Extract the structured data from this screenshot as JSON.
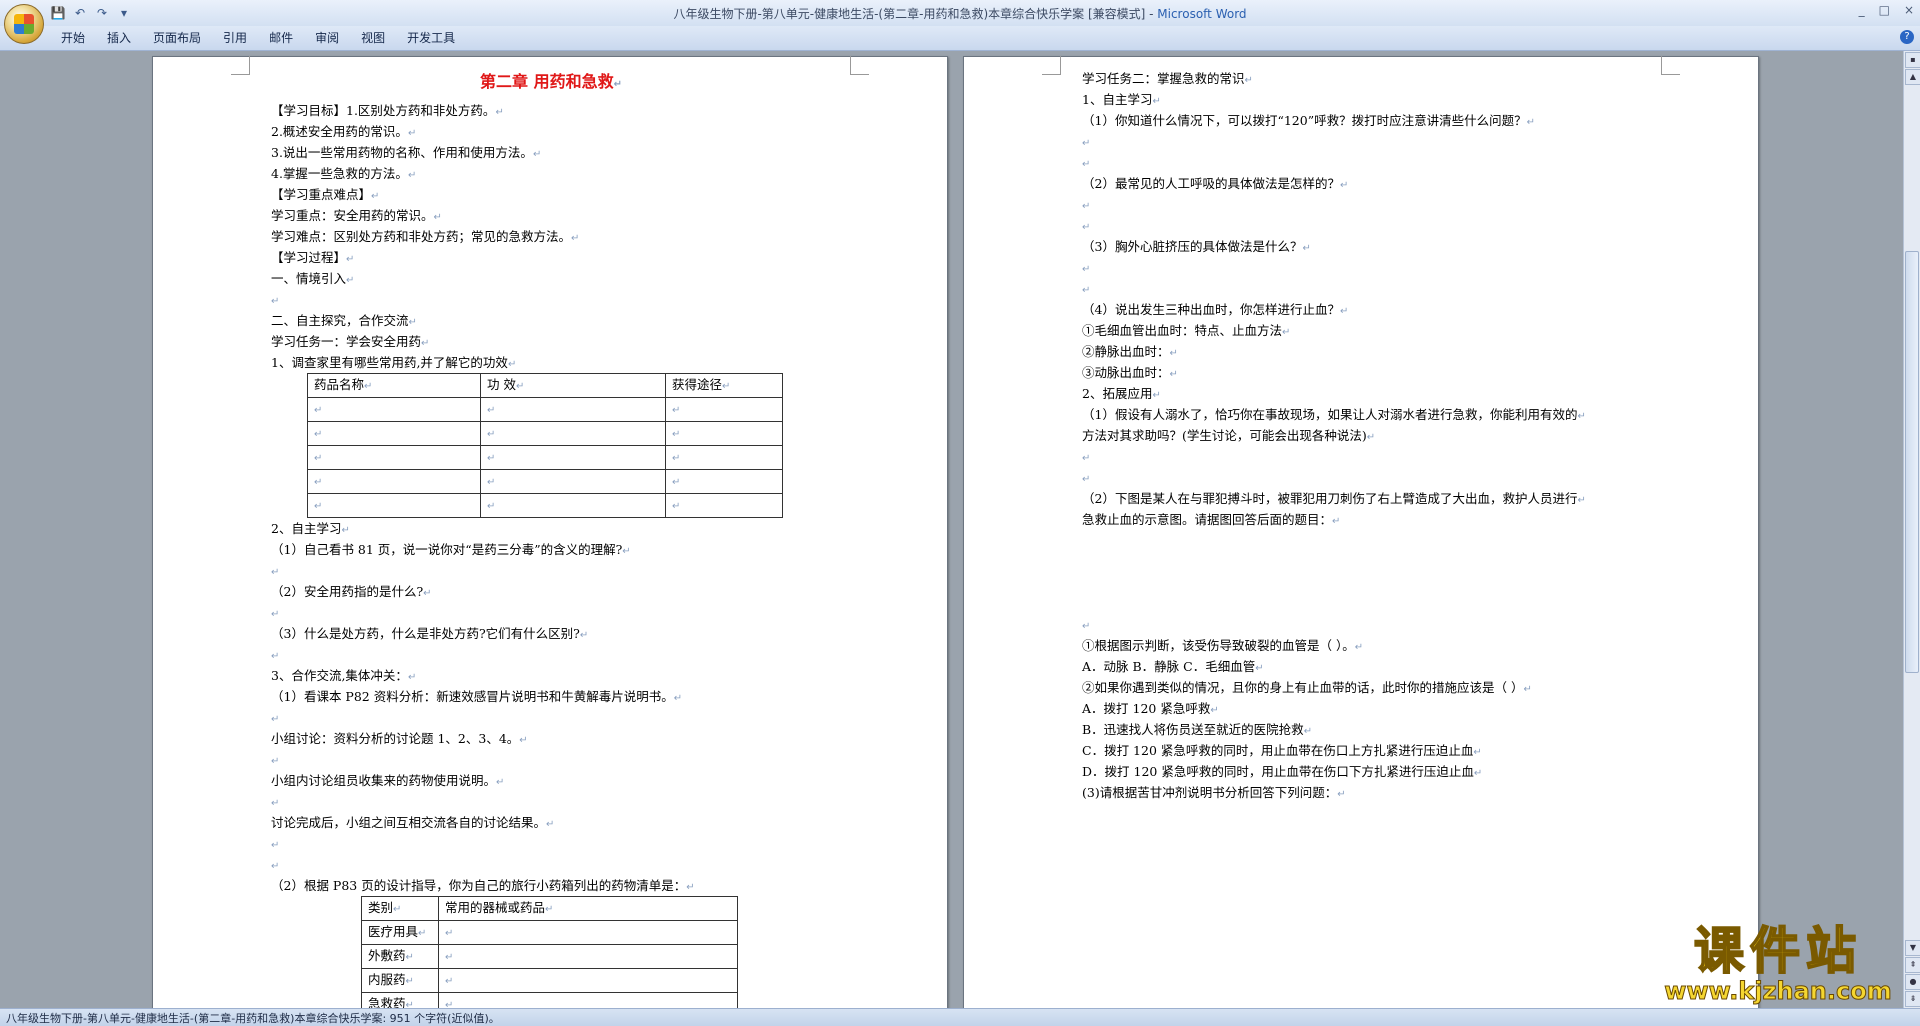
{
  "window": {
    "title": "八年级生物下册-第八单元-健康地生活-(第二章-用药和急救)本章综合快乐学案 [兼容模式] - ",
    "app": "Microsoft Word",
    "controls": [
      "_",
      "□",
      "×"
    ]
  },
  "quick_access": {
    "save": "💾",
    "undo": "↶",
    "redo": "↷",
    "customize": "▾"
  },
  "ribbon_tabs": [
    "开始",
    "插入",
    "页面布局",
    "引用",
    "邮件",
    "审阅",
    "视图",
    "开发工具"
  ],
  "page1": {
    "title": "第二章  用药和急救",
    "lines_a": [
      "【学习目标】1.区别处方药和非处方药。",
      "2.概述安全用药的常识。",
      "3.说出一些常用药物的名称、作用和使用方法。",
      "4.掌握一些急救的方法。",
      "【学习重点难点】",
      "学习重点：安全用药的常识。",
      "学习难点：区别处方药和非处方药；常见的急救方法。",
      "【学习过程】",
      "一、情境引入",
      "",
      "二、自主探究，合作交流",
      "学习任务一：学会安全用药",
      "1、调查家里有哪些常用药,并了解它的功效"
    ],
    "table1": {
      "headers": [
        "药品名称",
        "功        效",
        "获得途径"
      ],
      "empty_rows": 5
    },
    "lines_b": [
      "2、自主学习",
      "（1）自己看书 81 页，说一说你对“是药三分毒”的含义的理解?",
      "",
      "（2）安全用药指的是什么?",
      "",
      "（3）什么是处方药，什么是非处方药?它们有什么区别?",
      "",
      "3、合作交流,集体冲关：",
      "（1）看课本 P82 资料分析：新速效感冒片说明书和牛黄解毒片说明书。",
      "",
      "小组讨论：资料分析的讨论题 1、2、3、4。",
      "",
      "小组内讨论组员收集来的药物使用说明。",
      "",
      "讨论完成后，小组之间互相交流各自的讨论结果。",
      "",
      "",
      "（2）根据 P83 页的设计指导，你为自己的旅行小药箱列出的药物清单是："
    ],
    "table2": {
      "headers": [
        "类别",
        "常用的器械或药品"
      ],
      "rows": [
        "医疗用具",
        "外敷药",
        "内服药",
        "急救药"
      ]
    }
  },
  "page2": {
    "lines": [
      "学习任务二：掌握急救的常识",
      "1、自主学习",
      "（1）你知道什么情况下，可以拨打“120”呼救？拨打时应注意讲清些什么问题？",
      "",
      "",
      "（2）最常见的人工呼吸的具体做法是怎样的？",
      "",
      "",
      "（3）胸外心脏挤压的具体做法是什么？",
      "",
      "",
      "（4）说出发生三种出血时，你怎样进行止血？",
      "①毛细血管出血时：特点、止血方法",
      "②静脉出血时：",
      "③动脉出血时：",
      "2、拓展应用",
      "（1）假设有人溺水了，恰巧你在事故现场，如果让人对溺水者进行急救，你能利用有效的",
      "方法对其求助吗？(学生讨论，可能会出现各种说法)",
      "",
      "",
      "（2）下图是某人在与罪犯搏斗时，被罪犯用刀刺伤了右上臂造成了大出血，救护人员进行",
      "急救止血的示意图。请据图回答后面的题目："
    ],
    "lines_c": [
      "",
      "①根据图示判断，该受伤导致破裂的血管是（         ）。",
      "A．动脉            B．静脉            C．毛细血管",
      "②如果你遇到类似的情况，且你的身上有止血带的话，此时你的措施应该是（         ）",
      "A．拨打 120 紧急呼救",
      "B．迅速找人将伤员送至就近的医院抢救",
      "C．拨打 120 紧急呼救的同时，用止血带在伤口上方扎紧进行压迫止血",
      "D．拨打 120 紧急呼救的同时，用止血带在伤口下方扎紧进行压迫止血",
      "(3)请根据苦甘冲剂说明书分析回答下列问题："
    ]
  },
  "paragraph_mark": "↵",
  "status": "八年级生物下册-第八单元-健康地生活-(第二章-用药和急救)本章综合快乐学案: 951 个字符(近似值)。",
  "watermark": {
    "cn": "课件站",
    "url": "www.kjzhan.com"
  }
}
